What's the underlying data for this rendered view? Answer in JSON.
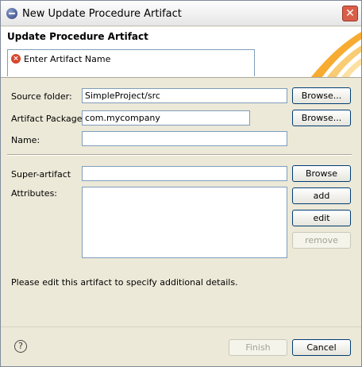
{
  "window": {
    "title": "New Update Procedure Artifact"
  },
  "banner": {
    "title": "Update Procedure Artifact",
    "message": "Enter Artifact Name"
  },
  "form": {
    "source_folder": {
      "label": "Source folder:",
      "value": "SimpleProject/src",
      "browse_label": "Browse..."
    },
    "artifact_package": {
      "label": "Artifact Package:",
      "value": "com.mycompany",
      "browse_label": "Browse..."
    },
    "name": {
      "label": "Name:",
      "value": ""
    },
    "super_artifact": {
      "label": "Super-artifact",
      "value": "",
      "browse_label": "Browse"
    },
    "attributes": {
      "label": "Attributes:",
      "add_label": "add",
      "edit_label": "edit",
      "remove_label": "remove"
    },
    "info_text": "Please edit this artifact to specify additional details."
  },
  "footer": {
    "finish_label": "Finish",
    "cancel_label": "Cancel"
  },
  "colors": {
    "accent_border": "#003c74",
    "error": "#d6452b"
  }
}
